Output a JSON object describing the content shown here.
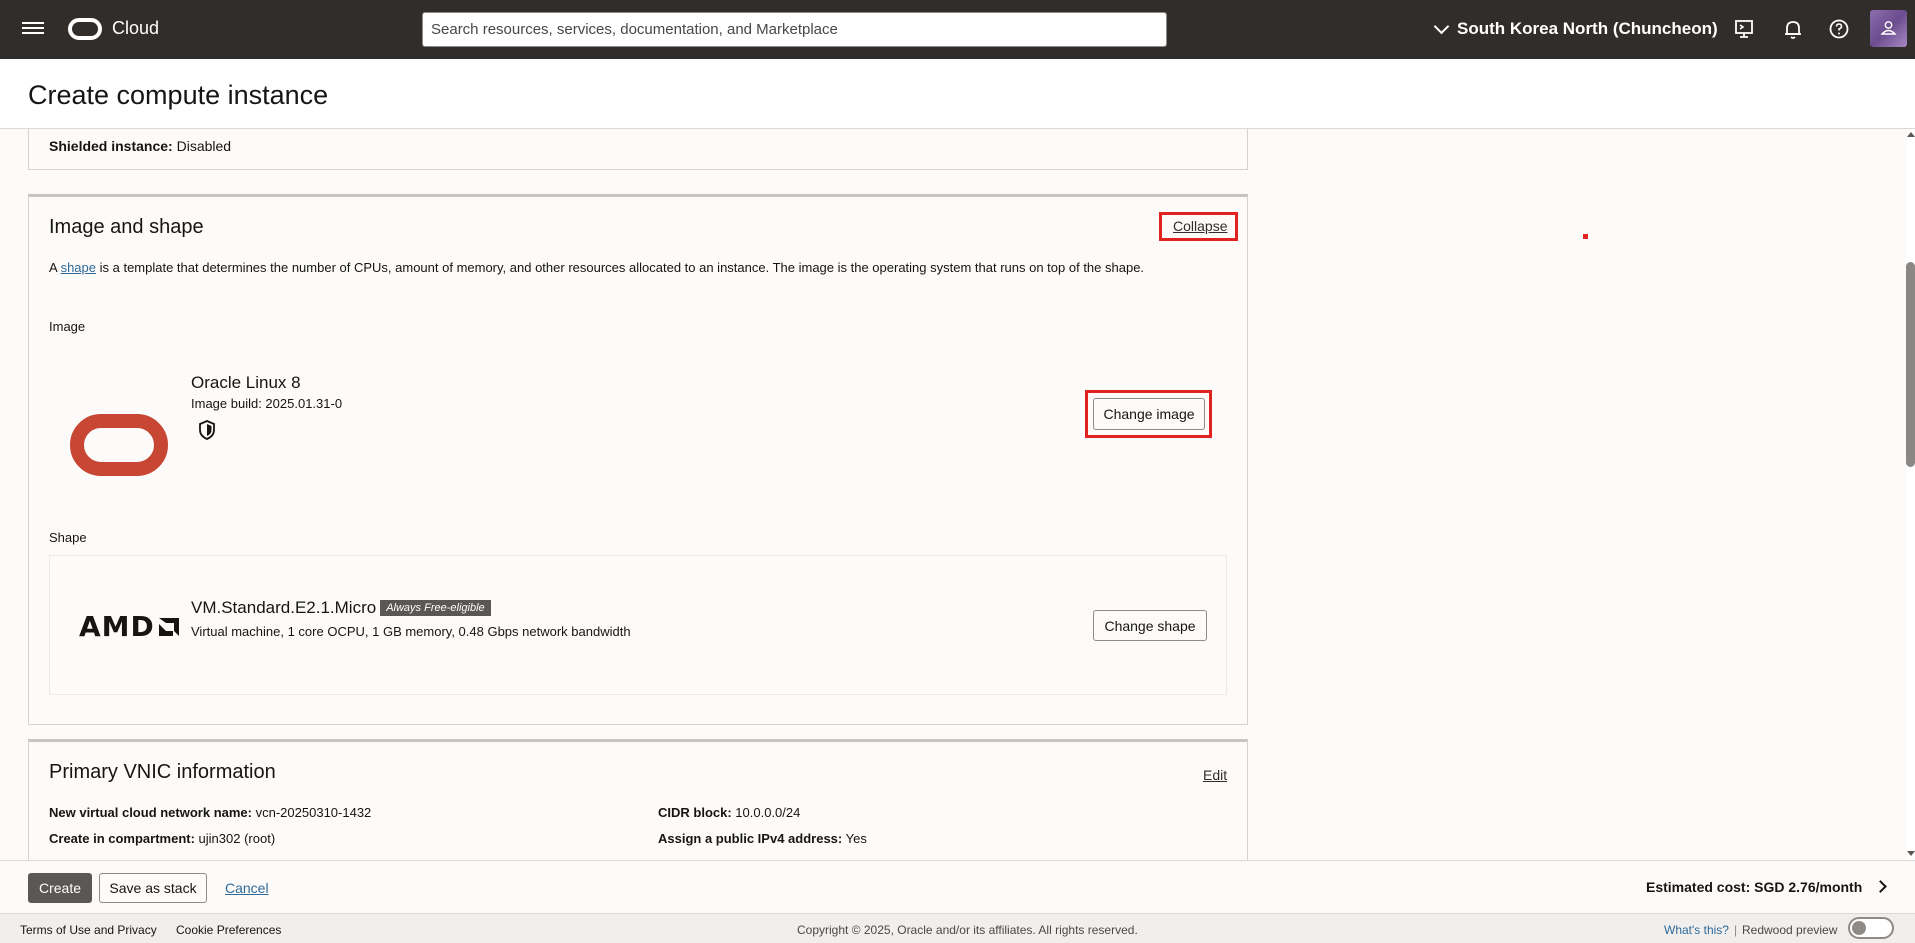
{
  "header": {
    "brand": "Cloud",
    "search_placeholder": "Search resources, services, documentation, and Marketplace",
    "region": "South Korea North (Chuncheon)"
  },
  "page": {
    "title": "Create compute instance"
  },
  "security_summary": {
    "shielded_label": "Shielded instance:",
    "shielded_value": "Disabled"
  },
  "image_and_shape": {
    "title": "Image and shape",
    "collapse_label": "Collapse",
    "desc_prefix": "A ",
    "desc_link": "shape",
    "desc_suffix": " is a template that determines the number of CPUs, amount of memory, and other resources allocated to an instance. The image is the operating system that runs on top of the shape.",
    "image_label": "Image",
    "image_name": "Oracle Linux 8",
    "image_build": "Image build: 2025.01.31-0",
    "change_image_label": "Change image",
    "shape_label": "Shape",
    "shape_vendor": "AMD",
    "shape_name": "VM.Standard.E2.1.Micro",
    "shape_badge": "Always Free-eligible",
    "shape_desc": "Virtual machine, 1 core OCPU, 1 GB memory, 0.48 Gbps network bandwidth",
    "change_shape_label": "Change shape"
  },
  "vnic": {
    "title": "Primary VNIC information",
    "edit_label": "Edit",
    "vcn_label": "New virtual cloud network name:",
    "vcn_value": "vcn-20250310-1432",
    "compartment_label": "Create in compartment:",
    "compartment_value": "ujin302 (root)",
    "cidr_label": "CIDR block:",
    "cidr_value": "10.0.0.0/24",
    "public_ip_label": "Assign a public IPv4 address:",
    "public_ip_value": "Yes"
  },
  "actions": {
    "create": "Create",
    "save_stack": "Save as stack",
    "cancel": "Cancel",
    "estimated_cost_label": "Estimated cost:",
    "estimated_cost_value": "SGD 2.76/month"
  },
  "footer": {
    "terms": "Terms of Use and Privacy",
    "cookies": "Cookie Preferences",
    "copyright": "Copyright © 2025, Oracle and/or its affiliates. All rights reserved.",
    "whats_this": "What's this?",
    "redwood": "Redwood preview"
  },
  "colors": {
    "header_bg": "#312d2a",
    "oracle_red": "#c74634",
    "highlight": "#e1231f",
    "link": "#2f6a9a"
  }
}
